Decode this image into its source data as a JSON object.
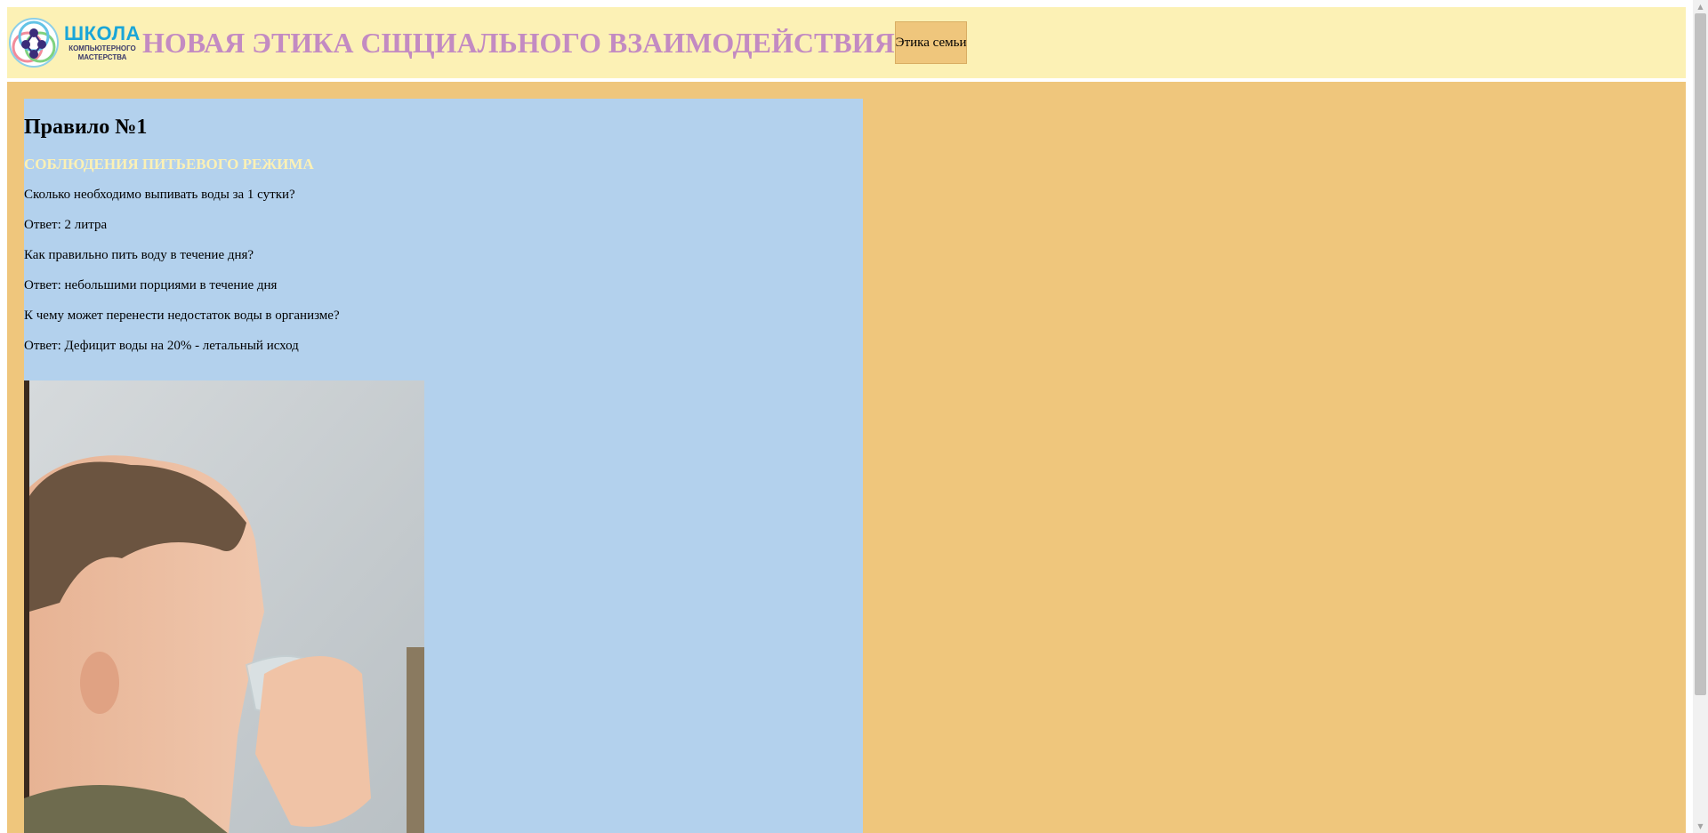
{
  "header": {
    "logo_title": "ШКОЛА",
    "logo_subtitle_1": "КОМПЬЮТЕРНОГО",
    "logo_subtitle_2": "МАСТЕРСТВА",
    "site_title": "НОВАЯ ЭТИКА СЩЦИАЛЬНОГО ВЗАИМОДЕЙСТВИЯ",
    "nav_label": "Этика семьи"
  },
  "article": {
    "heading": "Правило №1",
    "subheading": "СОБЛЮДЕНИЯ ПИТЬЕВОГО РЕЖИМА",
    "lines": [
      "Сколько необходимо выпивать воды за 1 сутки?",
      "Ответ: 2 литра",
      "Как правильно пить воду в течение дня?",
      "Ответ: небольшими порциями в течение дня",
      "К чему может перенести недостаток воды в организме?",
      "Ответ: Дефицит воды на 20% - летальный исход"
    ]
  },
  "scrollbar": {
    "up_arrow": "▲",
    "down_arrow": "▼"
  }
}
